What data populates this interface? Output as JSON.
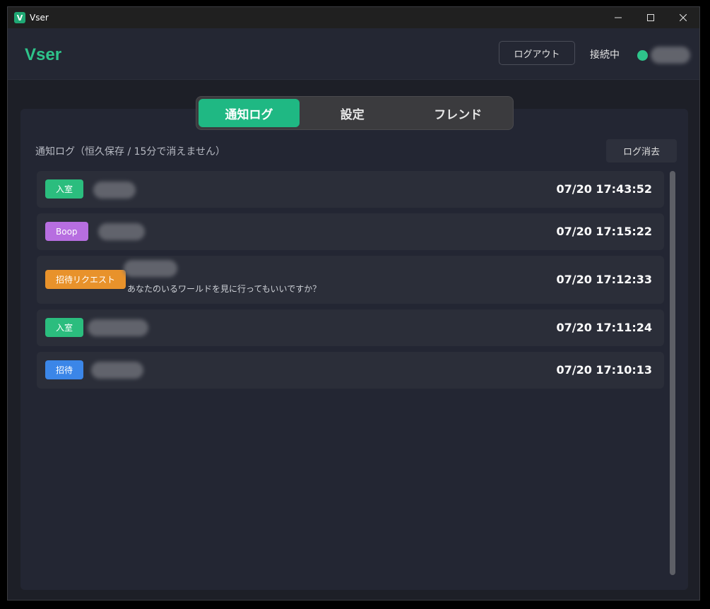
{
  "window": {
    "title": "Vser",
    "app_icon_letter": "V",
    "minimize_icon": "minimize-icon",
    "maximize_icon": "maximize-icon",
    "close_icon": "close-icon"
  },
  "header": {
    "brand": "Vser",
    "logout_label": "ログアウト",
    "connection_label": "接続中"
  },
  "tabs": [
    {
      "label": "通知ログ",
      "active": true
    },
    {
      "label": "設定",
      "active": false
    },
    {
      "label": "フレンド",
      "active": false
    }
  ],
  "log_section": {
    "title": "通知ログ（恒久保存 / 15分で消えません）",
    "clear_label": "ログ消去"
  },
  "entries": [
    {
      "badge": "入室",
      "badge_color": "#2bbd7e",
      "time": "07/20 17:43:52",
      "message": ""
    },
    {
      "badge": "Boop",
      "badge_color": "#b76ee0",
      "time": "07/20 17:15:22",
      "message": ""
    },
    {
      "badge": "招待リクエスト",
      "badge_color": "#e8922b",
      "time": "07/20 17:12:33",
      "message": "あなたのいるワールドを見に行ってもいいですか？"
    },
    {
      "badge": "入室",
      "badge_color": "#2bbd7e",
      "time": "07/20 17:11:24",
      "message": ""
    },
    {
      "badge": "招待",
      "badge_color": "#3b86e8",
      "time": "07/20 17:10:13",
      "message": ""
    }
  ],
  "colors": {
    "accent": "#2ec48b",
    "background": "#1d1f27",
    "panel": "#232633",
    "row": "#2b2e39"
  }
}
